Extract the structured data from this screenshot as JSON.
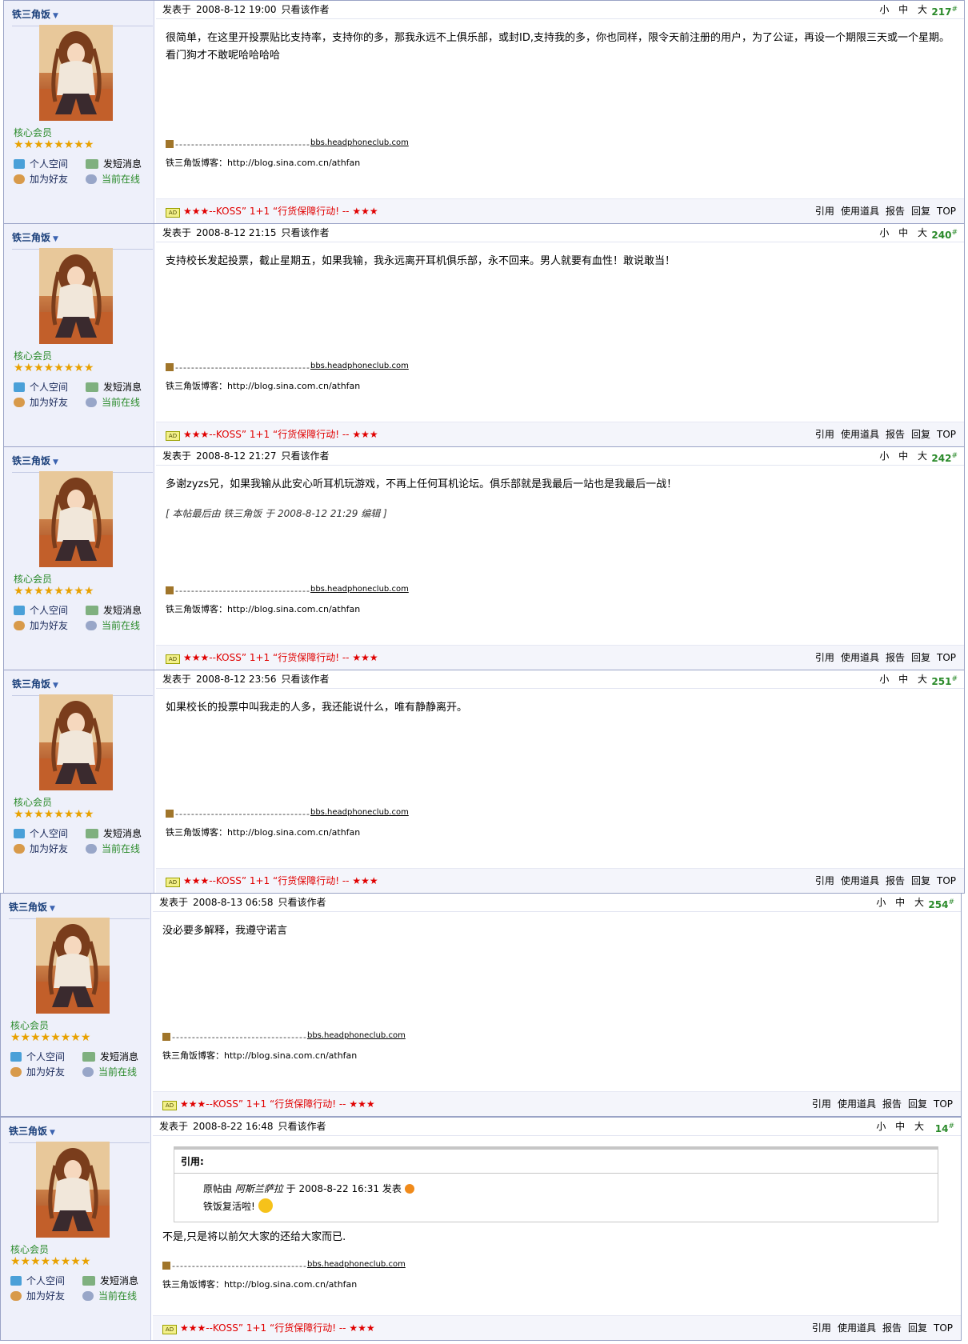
{
  "common": {
    "author": "铁三角饭",
    "group": "核心会员",
    "stars": "★★★★★★★★",
    "space": "个人空间",
    "pm": "发短消息",
    "add_friend": "加为好友",
    "online": "当前在线",
    "only_author": "只看该作者",
    "posted_label": "发表于",
    "sizes": "小 中 大",
    "sig_dashes": "----------------------------------",
    "sig_site": "bbs.headphoneclub.com",
    "sig_blog": "铁三角饭博客：http://blog.sina.com.cn/athfan",
    "ad_badge": "AD",
    "ad_text": "★★★--KOSS” 1+1 “行货保障行动! -- ★★★",
    "actions": [
      "引用",
      "使用道具",
      "报告",
      "回复",
      "TOP"
    ]
  },
  "posts": [
    {
      "time": "2008-8-12 19:00",
      "floor": "217",
      "body": "很简单，在这里开投票贴比支持率，支持你的多，那我永远不上俱乐部，或封ID,支持我的多，你也同样，限令天前注册的用户，为了公证，再设一个期限三天或一个星期。看门狗才不敢呢哈哈哈哈",
      "edit": ""
    },
    {
      "time": "2008-8-12 21:15",
      "floor": "240",
      "body": "支持校长发起投票，截止星期五，如果我输，我永远离开耳机俱乐部，永不回来。男人就要有血性！敢说敢当！",
      "edit": ""
    },
    {
      "time": "2008-8-12 21:27",
      "floor": "242",
      "body": "多谢zyzs兄，如果我输从此安心听耳机玩游戏，不再上任何耳机论坛。俱乐部就是我最后一站也是我最后一战！",
      "edit": "[ 本帖最后由 铁三角饭 于 2008-8-12 21:29 编辑 ]"
    },
    {
      "time": "2008-8-12 23:56",
      "floor": "251",
      "body": "如果校长的投票中叫我走的人多，我还能说什么，唯有静静离开。",
      "edit": ""
    },
    {
      "time": "2008-8-13 06:58",
      "floor": "254",
      "body": "没必要多解释，我遵守诺言",
      "edit": ""
    },
    {
      "time": "2008-8-22 16:48",
      "floor": "14",
      "body": "不是,只是将以前欠大家的还给大家而已.",
      "edit": "",
      "quote": {
        "label": "引用:",
        "prefix": "原帖由",
        "user": "阿斯兰萨拉",
        "mid": "于",
        "time": "2008-8-22 16:31",
        "suffix": "发表",
        "text": "铁饭复活啦!"
      }
    }
  ]
}
